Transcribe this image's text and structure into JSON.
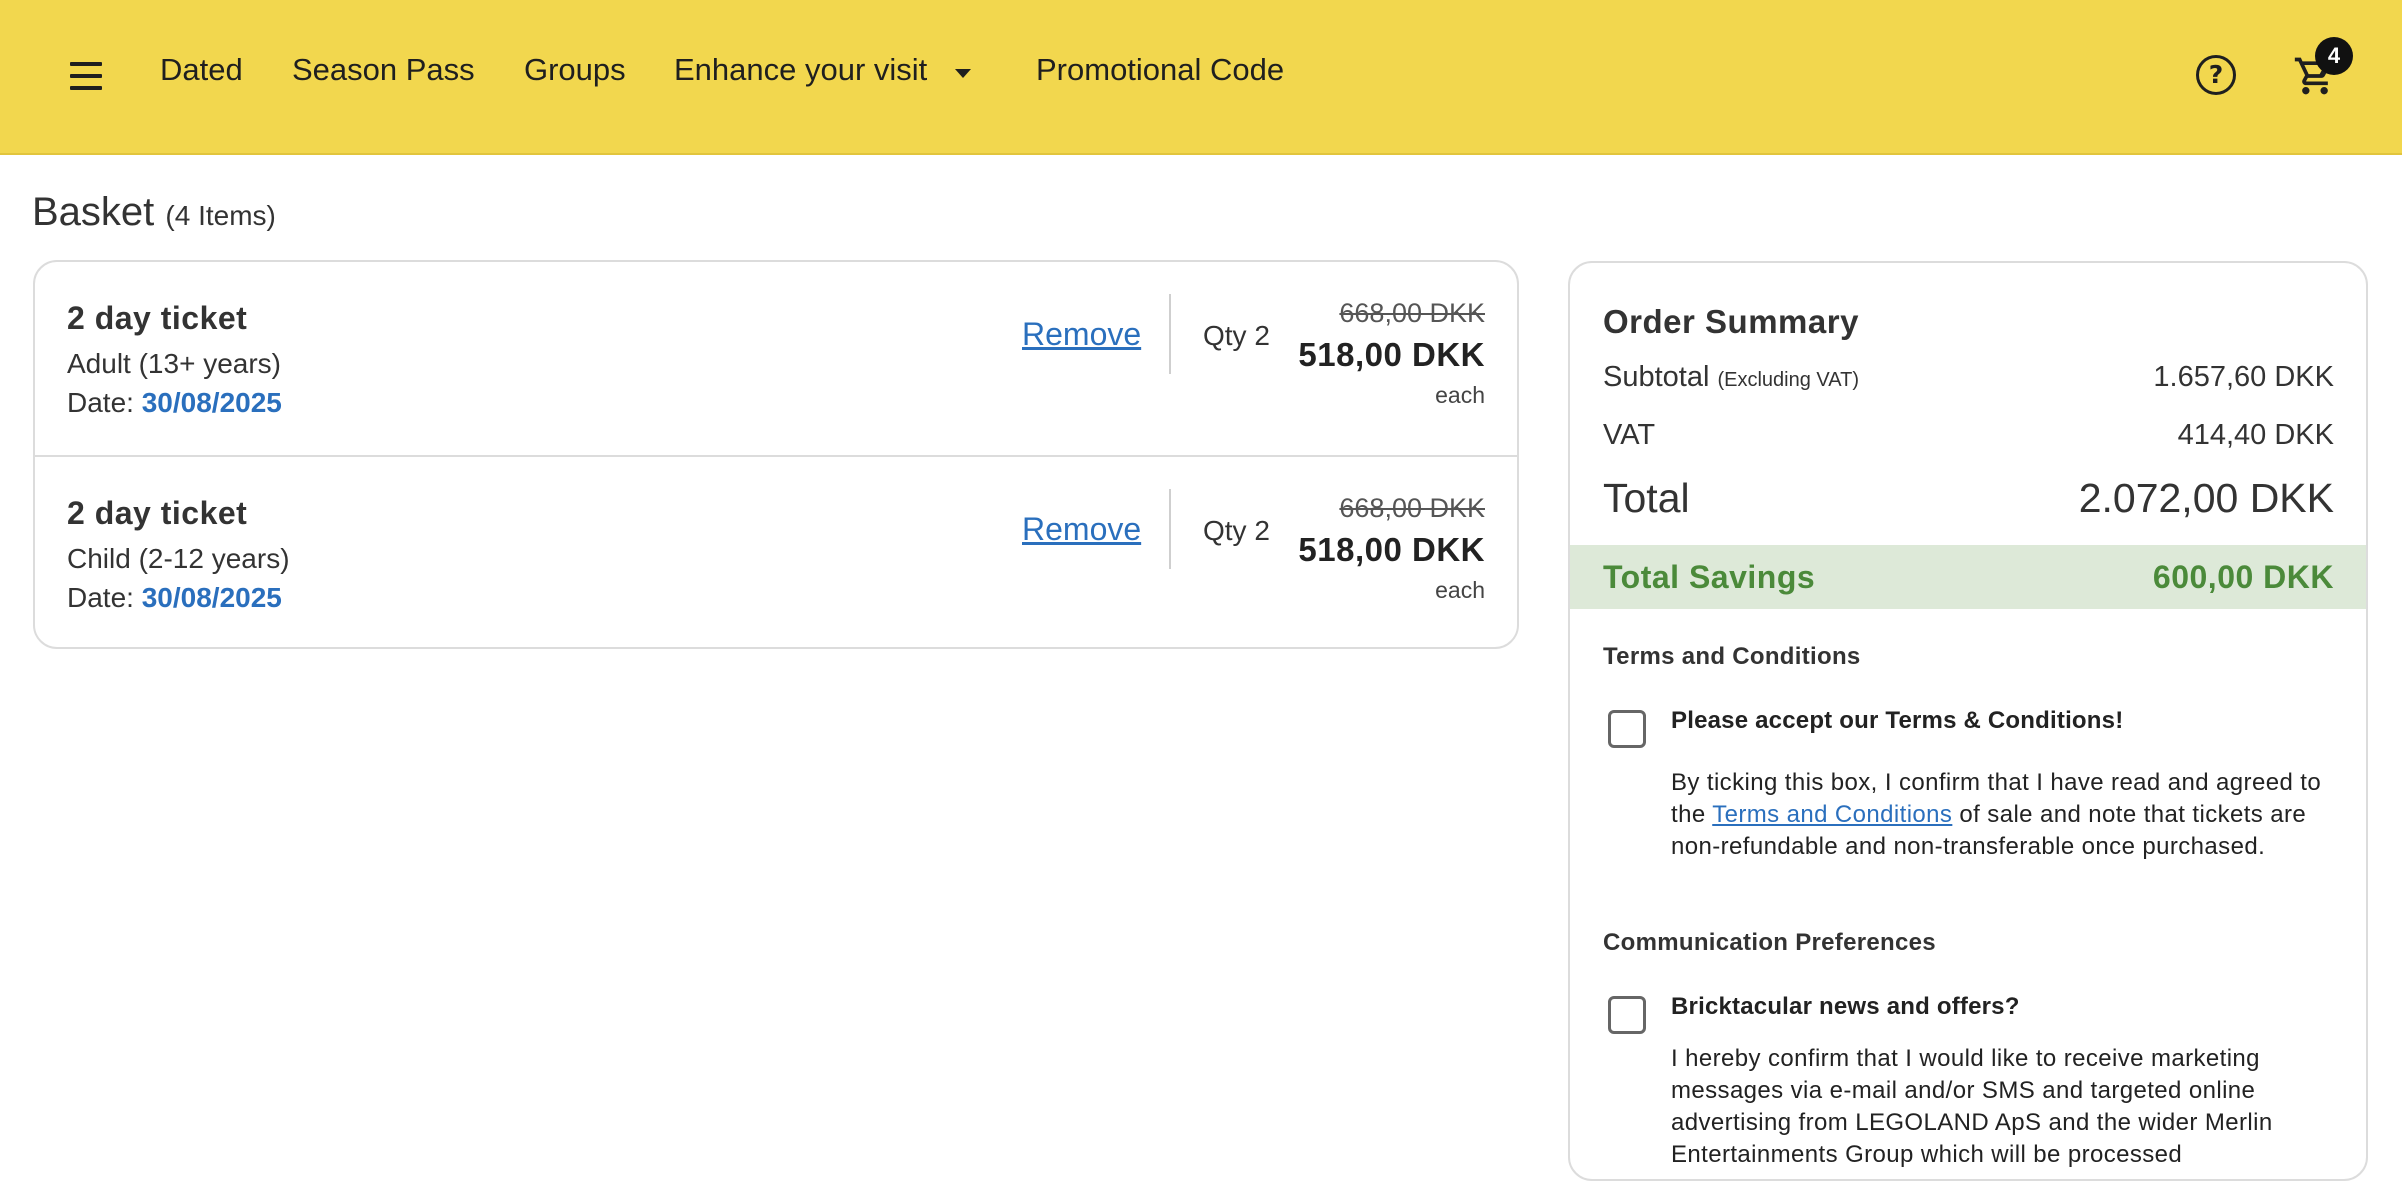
{
  "nav": {
    "items": [
      "Dated",
      "Season Pass",
      "Groups",
      "Enhance your visit",
      "Promotional Code"
    ],
    "help_glyph": "?",
    "cart_count": "4",
    "icons": {
      "menu": "hamburger-icon",
      "dropdown": "chevron-down-icon",
      "help": "question-circle-icon",
      "cart": "shopping-cart-icon"
    }
  },
  "basket": {
    "title": "Basket",
    "count": "(4 Items)",
    "items": [
      {
        "name": "2 day ticket",
        "type": "Adult (13+ years)",
        "date_label": "Date:",
        "date": "30/08/2025",
        "remove": "Remove",
        "qty": "Qty 2",
        "old_price": "668,00 DKK",
        "price": "518,00 DKK",
        "unit": "each"
      },
      {
        "name": "2 day ticket",
        "type": "Child (2-12 years)",
        "date_label": "Date:",
        "date": "30/08/2025",
        "remove": "Remove",
        "qty": "Qty 2",
        "old_price": "668,00 DKK",
        "price": "518,00 DKK",
        "unit": "each"
      }
    ]
  },
  "summary": {
    "title": "Order Summary",
    "subtotal_label": "Subtotal",
    "subtotal_note": "(Excluding VAT)",
    "subtotal": "1.657,60 DKK",
    "vat_label": "VAT",
    "vat": "414,40 DKK",
    "total_label": "Total",
    "total": "2.072,00 DKK",
    "savings_label": "Total Savings",
    "savings": "600,00 DKK",
    "terms": {
      "heading": "Terms and Conditions",
      "checkbox_label": "Please accept our Terms & Conditions!",
      "text_before": "By ticking this box, I confirm that I have read and agreed to the",
      "link": "Terms and Conditions",
      "text_after": "of sale and note that tickets are non-refundable and non-transferable once purchased.",
      "checked": false
    },
    "comms": {
      "heading": "Communication Preferences",
      "checkbox_label": "Bricktacular news and offers?",
      "text": "I hereby confirm that I would like to receive marketing messages via e-mail and/or SMS and targeted online advertising from LEGOLAND ApS and the wider Merlin Entertainments Group which will be processed",
      "checked": false
    }
  },
  "colors": {
    "header_bg": "#f2d74e",
    "link": "#2a6fbd",
    "savings_bg": "#dde9d8",
    "savings_text": "#4b8a3a"
  }
}
